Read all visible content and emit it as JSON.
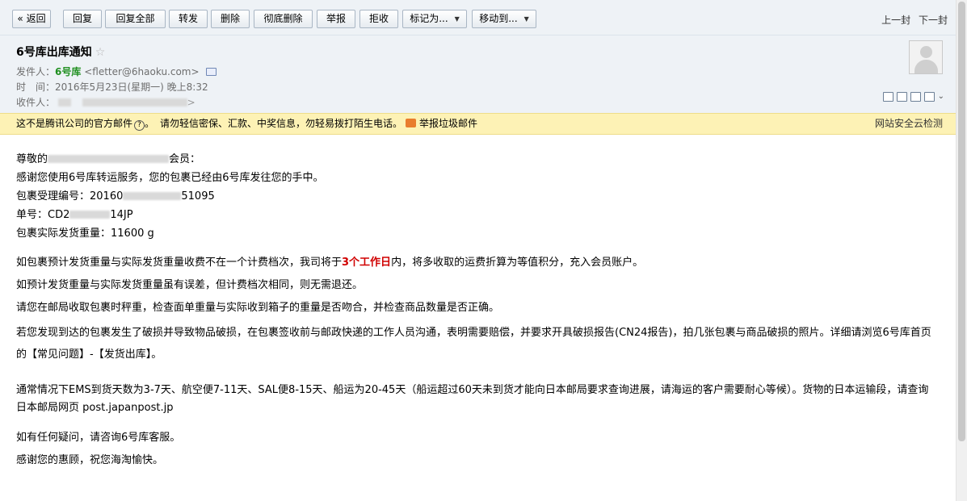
{
  "toolbar": {
    "back": "« 返回",
    "reply": "回复",
    "reply_all": "回复全部",
    "forward": "转发",
    "delete": "删除",
    "delete_forever": "彻底删除",
    "report": "举报",
    "reject": "拒收",
    "mark_as": "标记为...",
    "move_to": "移动到...",
    "prev": "上一封",
    "next": "下一封"
  },
  "email": {
    "subject": "6号库出库通知",
    "from_label": "发件人：",
    "from_name": "6号库",
    "from_addr": "<fletter@6haoku.com>",
    "time_label": "时　间：",
    "time_value": "2016年5月23日(星期一) 晚上8:32",
    "to_label": "收件人："
  },
  "warning": {
    "not_official": "这不是腾讯公司的官方邮件",
    "caution": "请勿轻信密保、汇款、中奖信息，勿轻易拨打陌生电话。",
    "report_spam": "举报垃圾邮件",
    "security": "网站安全云检测"
  },
  "body": {
    "greet_a": "尊敬的",
    "greet_b": "会员：",
    "thanks": "感谢您使用6号库转运服务，您的包裹已经由6号库发往您的手中。",
    "pkg_id_label": "包裹受理编号：",
    "pkg_id_a": "20160",
    "pkg_id_b": "51095",
    "track_label": "单号：",
    "track_a": "CD2",
    "track_b": "14JP",
    "weight_label": "包裹实际发货重量：",
    "weight_value": "11600 g",
    "p1_a": "如包裹预计发货重量与实际发货重量收费不在一个计费档次，我司将于",
    "p1_red": "3个工作日",
    "p1_b": "内，将多收取的运费折算为等值积分，充入会员账户。",
    "p2": "如预计发货重量与实际发货重量虽有误差，但计费档次相同，则无需退还。",
    "p3": "请您在邮局收取包裹时秤重，检查面单重量与实际收到箱子的重量是否吻合，并检查商品数量是否正确。",
    "p4": "若您发现到达的包裹发生了破损并导致物品破损，在包裹签收前与邮政快递的工作人员沟通，表明需要赔偿，并要求开具破损报告(CN24报告)，拍几张包裹与商品破损的照片。详细请浏览6号库首页的【常见问题】-【发货出库】。",
    "p5": "通常情况下EMS到货天数为3-7天、航空便7-11天、SAL便8-15天、船运为20-45天（船运超过60天未到货才能向日本邮局要求查询进展，请海运的客户需要耐心等候）。货物的日本运输段，请查询日本邮局网页 post.japanpost.jp",
    "p6": "如有任何疑问，请咨询6号库客服。",
    "p7": "感谢您的惠顾，祝您海淘愉快。"
  }
}
